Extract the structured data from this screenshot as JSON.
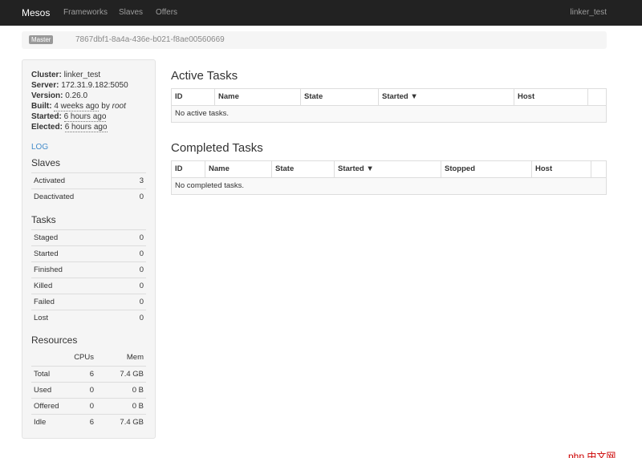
{
  "navbar": {
    "brand": "Mesos",
    "links": [
      "Frameworks",
      "Slaves",
      "Offers"
    ],
    "user": "linker_test"
  },
  "master": {
    "badge": "Master",
    "id": "7867dbf1-8a4a-436e-b021-f8ae00560669"
  },
  "sidebar": {
    "info": {
      "cluster_label": "Cluster:",
      "cluster": "linker_test",
      "server_label": "Server:",
      "server": "172.31.9.182:5050",
      "version_label": "Version:",
      "version": "0.26.0",
      "built_label": "Built:",
      "built_when": "4 weeks ago",
      "built_by_word": "by",
      "built_by": "root",
      "started_label": "Started:",
      "started": "6 hours ago",
      "elected_label": "Elected:",
      "elected": "6 hours ago"
    },
    "log_link": "LOG",
    "slaves": {
      "title": "Slaves",
      "rows": [
        {
          "label": "Activated",
          "value": "3"
        },
        {
          "label": "Deactivated",
          "value": "0"
        }
      ]
    },
    "tasks": {
      "title": "Tasks",
      "rows": [
        {
          "label": "Staged",
          "value": "0"
        },
        {
          "label": "Started",
          "value": "0"
        },
        {
          "label": "Finished",
          "value": "0"
        },
        {
          "label": "Killed",
          "value": "0"
        },
        {
          "label": "Failed",
          "value": "0"
        },
        {
          "label": "Lost",
          "value": "0"
        }
      ]
    },
    "resources": {
      "title": "Resources",
      "columns": [
        "CPUs",
        "Mem"
      ],
      "rows": [
        {
          "label": "Total",
          "cpus": "6",
          "mem": "7.4 GB"
        },
        {
          "label": "Used",
          "cpus": "0",
          "mem": "0 B"
        },
        {
          "label": "Offered",
          "cpus": "0",
          "mem": "0 B"
        },
        {
          "label": "Idle",
          "cpus": "6",
          "mem": "7.4 GB"
        }
      ]
    }
  },
  "active_tasks": {
    "title": "Active Tasks",
    "columns": [
      "ID",
      "Name",
      "State",
      "Started ▼",
      "Host",
      ""
    ],
    "empty": "No active tasks."
  },
  "completed_tasks": {
    "title": "Completed Tasks",
    "columns": [
      "ID",
      "Name",
      "State",
      "Started ▼",
      "Stopped",
      "Host",
      ""
    ],
    "empty": "No completed tasks."
  },
  "watermark": "php 中文网"
}
